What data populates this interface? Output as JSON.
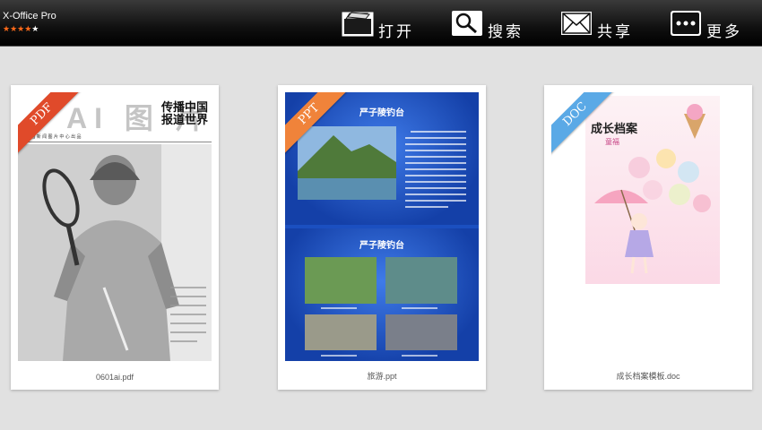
{
  "app": {
    "title": "X-Office Pro",
    "rating": {
      "filled": "★★★★",
      "last": "★"
    }
  },
  "toolbar": {
    "open_label": "打开",
    "search_label": "搜索",
    "share_label": "共享",
    "more_label": "更多"
  },
  "files": [
    {
      "name": "0601ai.pdf",
      "type": "PDF",
      "ribbon_color": "#e04a2a",
      "header_big": "AI 图 片",
      "header_slogan_1": "传播中国",
      "header_slogan_2": "报道世界",
      "header_sub": "中 国 新 闻 图 片 中 心 出 品"
    },
    {
      "name": "旅游.ppt",
      "type": "PPT",
      "ribbon_color": "#f0833a",
      "slide1_title": "严子陵钓台",
      "slide2_title": "严子陵钓台"
    },
    {
      "name": "成长档案模板.doc",
      "type": "DOC",
      "ribbon_color": "#5aa9e6",
      "title": "成长档案",
      "subtitle": "童福"
    }
  ],
  "colors": {
    "background": "#e1e1e1",
    "toolbar": "#101010",
    "star": "#ff6a1a"
  }
}
